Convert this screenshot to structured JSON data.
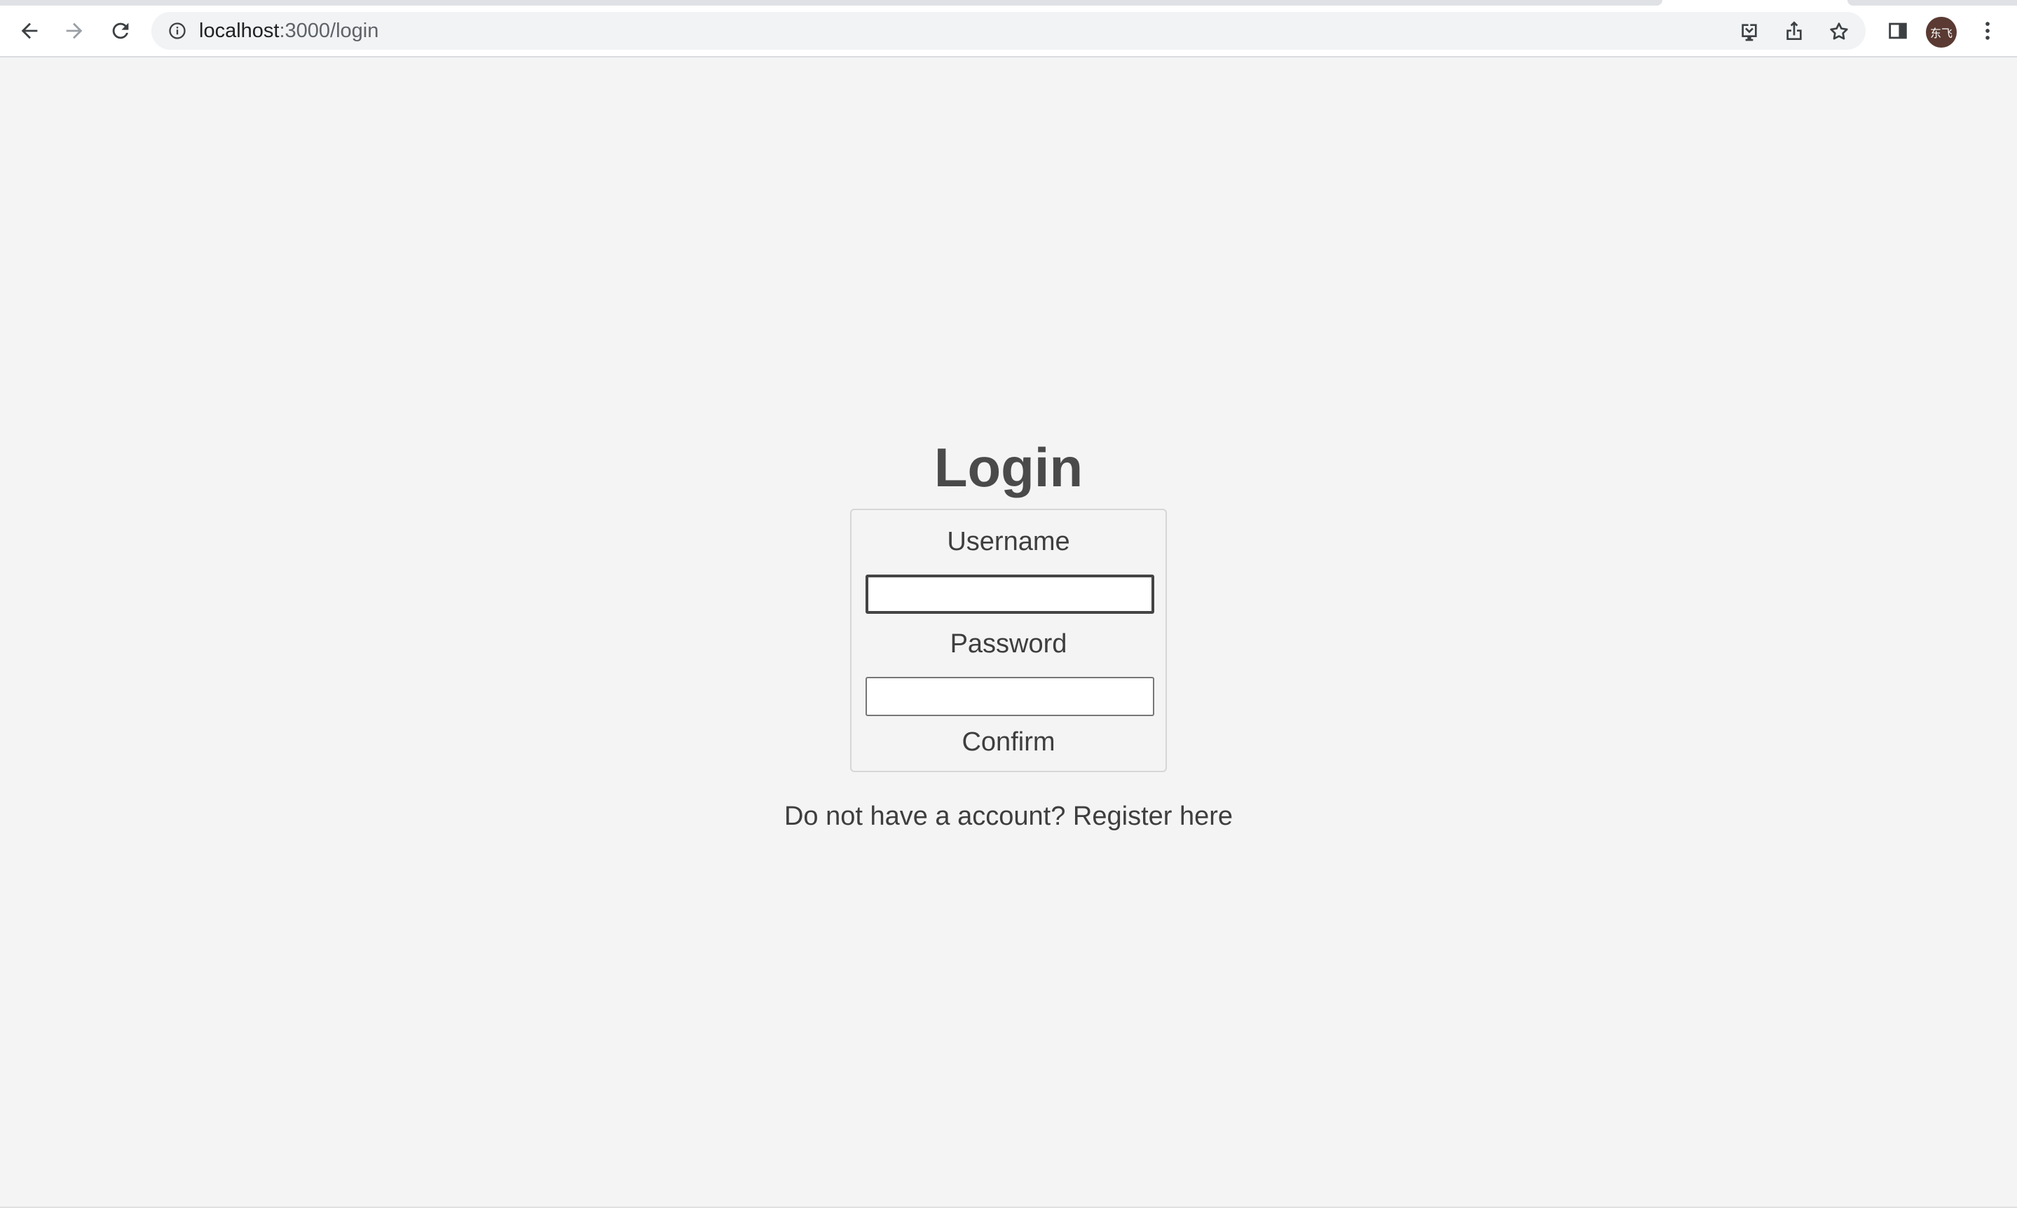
{
  "browser": {
    "url_host": "localhost",
    "url_path": ":3000/login",
    "avatar_text": "东飞"
  },
  "icons": {
    "back": "arrow-left-icon",
    "forward": "arrow-right-icon",
    "reload": "reload-icon",
    "site_info": "info-icon",
    "install": "install-app-icon",
    "share": "share-icon",
    "bookmark": "star-icon",
    "side_panel": "side-panel-icon",
    "menu": "kebab-menu-icon"
  },
  "login": {
    "title": "Login",
    "username_label": "Username",
    "username_value": "",
    "password_label": "Password",
    "password_value": "",
    "confirm_label": "Confirm",
    "register_prompt": "Do not have a account?",
    "register_link": "Register here"
  },
  "colors": {
    "page_background": "#f4f4f4",
    "text": "#3e3e3e",
    "title": "#4a4a4a",
    "form_border": "#d6d6d6"
  }
}
